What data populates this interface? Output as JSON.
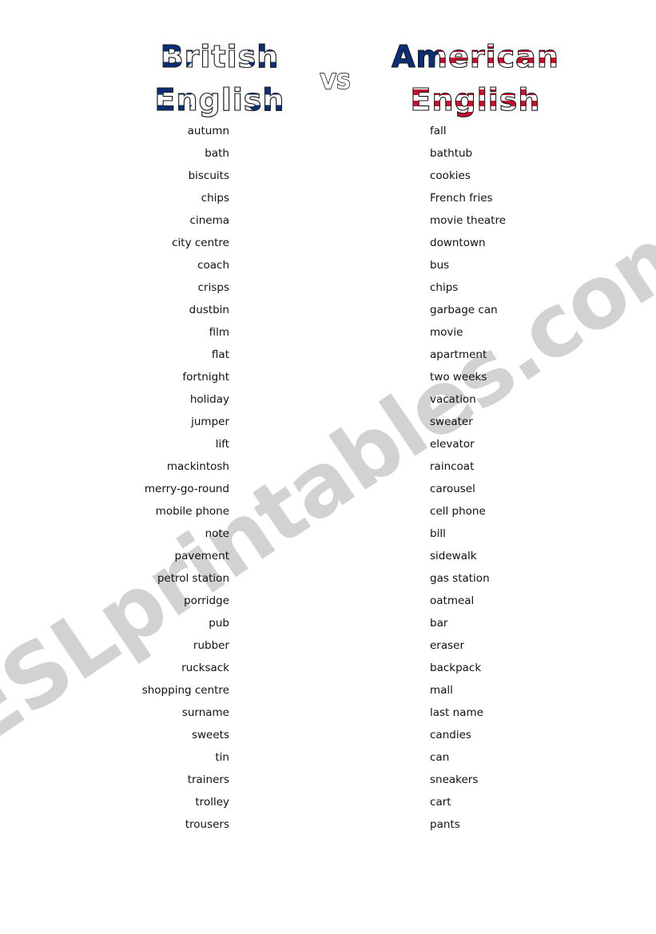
{
  "header": {
    "left_title_line1": "British",
    "left_title_line2": "English",
    "right_title_line1": "American",
    "right_title_line2": "English",
    "vs_label": "VS"
  },
  "watermark": {
    "text": "ESLprintables.com",
    "color": "#d2d2d2"
  },
  "colors": {
    "uk_blue": "#0b2f7a",
    "uk_red": "#c8102e",
    "us_blue": "#0b2f7a",
    "us_red": "#c8102e",
    "white": "#ffffff",
    "body_text": "#111111"
  },
  "word_pairs": [
    {
      "british": "autumn",
      "american": "fall"
    },
    {
      "british": "bath",
      "american": "bathtub"
    },
    {
      "british": "biscuits",
      "american": "cookies"
    },
    {
      "british": "chips",
      "american": "French fries"
    },
    {
      "british": "cinema",
      "american": "movie theatre"
    },
    {
      "british": "city centre",
      "american": "downtown"
    },
    {
      "british": "coach",
      "american": "bus"
    },
    {
      "british": "crisps",
      "american": "chips"
    },
    {
      "british": "dustbin",
      "american": "garbage can"
    },
    {
      "british": "film",
      "american": "movie"
    },
    {
      "british": "flat",
      "american": "apartment"
    },
    {
      "british": "fortnight",
      "american": "two weeks"
    },
    {
      "british": "holiday",
      "american": "vacation"
    },
    {
      "british": "jumper",
      "american": "sweater"
    },
    {
      "british": "lift",
      "american": "elevator"
    },
    {
      "british": "mackintosh",
      "american": "raincoat"
    },
    {
      "british": "merry-go-round",
      "american": "carousel"
    },
    {
      "british": "mobile phone",
      "american": "cell phone"
    },
    {
      "british": "note",
      "american": "bill"
    },
    {
      "british": "pavement",
      "american": "sidewalk"
    },
    {
      "british": "petrol station",
      "american": "gas station"
    },
    {
      "british": "porridge",
      "american": "oatmeal"
    },
    {
      "british": "pub",
      "american": "bar"
    },
    {
      "british": "rubber",
      "american": "eraser"
    },
    {
      "british": "rucksack",
      "american": "backpack"
    },
    {
      "british": "shopping centre",
      "american": "mall"
    },
    {
      "british": "surname",
      "american": "last name"
    },
    {
      "british": "sweets",
      "american": "candies"
    },
    {
      "british": "tin",
      "american": "can"
    },
    {
      "british": "trainers",
      "american": "sneakers"
    },
    {
      "british": "trolley",
      "american": "cart"
    },
    {
      "british": "trousers",
      "american": "pants"
    }
  ]
}
